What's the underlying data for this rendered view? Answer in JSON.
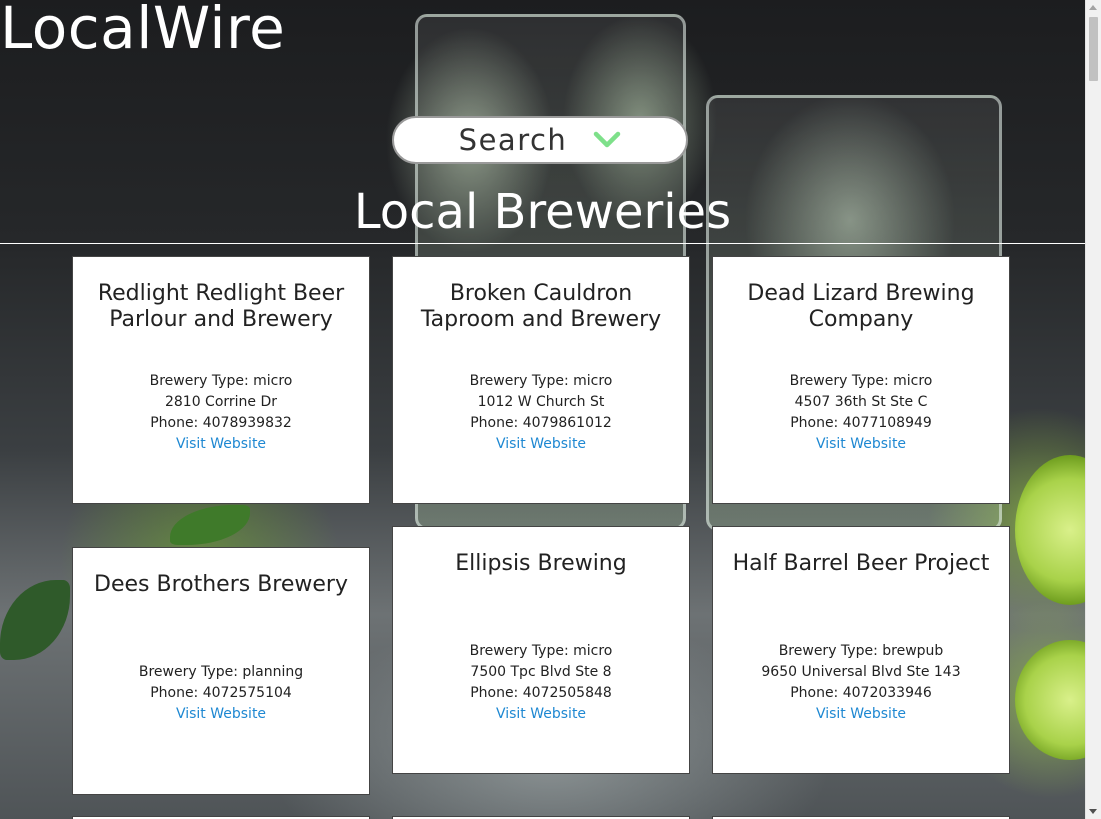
{
  "app": {
    "brand": "LocalWire"
  },
  "search": {
    "label": "Search",
    "icon": "chevron-down-icon",
    "icon_color": "#7ee08a"
  },
  "section": {
    "heading": "Local Breweries"
  },
  "colors": {
    "link": "#1e88d2",
    "card_bg": "#ffffff",
    "text": "#222222"
  },
  "breweries": [
    {
      "name": "Redlight Redlight Beer Parlour and Brewery",
      "type_line": "Brewery Type: micro",
      "address": "2810 Corrine Dr",
      "phone_line": "Phone: 4078939832",
      "link_label": "Visit Website"
    },
    {
      "name": "Broken Cauldron Taproom and Brewery",
      "type_line": "Brewery Type: micro",
      "address": "1012 W Church St",
      "phone_line": "Phone: 4079861012",
      "link_label": "Visit Website"
    },
    {
      "name": "Dead Lizard Brewing Company",
      "type_line": "Brewery Type: micro",
      "address": "4507 36th St Ste C",
      "phone_line": "Phone: 4077108949",
      "link_label": "Visit Website"
    },
    {
      "name": "Dees Brothers Brewery",
      "type_line": "Brewery Type: planning",
      "phone_line": "Phone: 4072575104",
      "link_label": "Visit Website"
    },
    {
      "name": "Ellipsis Brewing",
      "type_line": "Brewery Type: micro",
      "address": "7500 Tpc Blvd Ste 8",
      "phone_line": "Phone: 4072505848",
      "link_label": "Visit Website"
    },
    {
      "name": "Half Barrel Beer Project",
      "type_line": "Brewery Type: brewpub",
      "address": "9650 Universal Blvd Ste 143",
      "phone_line": "Phone: 4072033946",
      "link_label": "Visit Website"
    }
  ]
}
